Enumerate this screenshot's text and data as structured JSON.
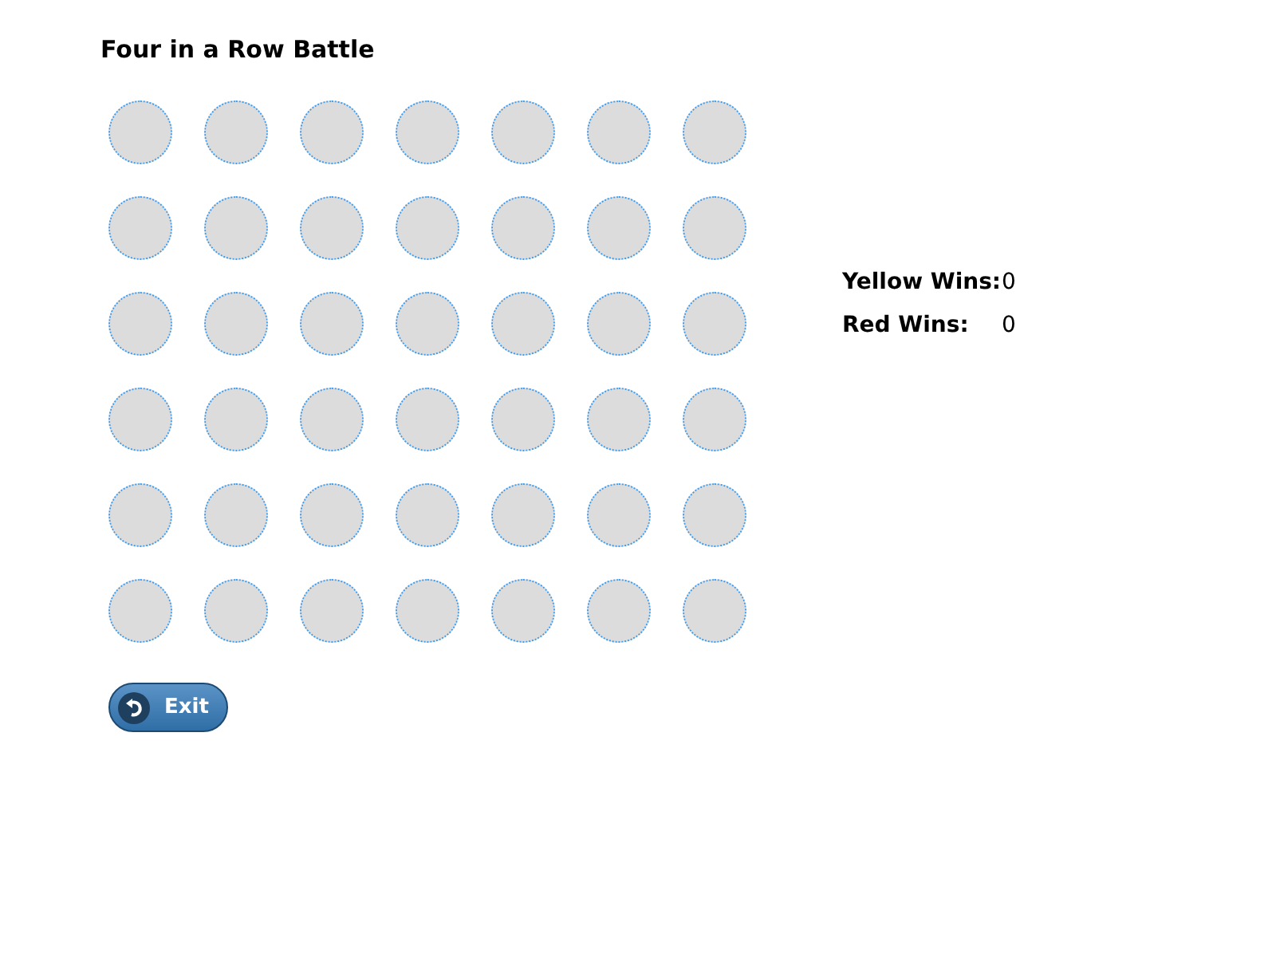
{
  "title": "Four in a Row Battle",
  "board": {
    "rows": [
      {
        "cells": [
          {
            "color": "#dcdcdc"
          },
          {
            "color": "#dcdcdc"
          },
          {
            "color": "#dcdcdc"
          },
          {
            "color": "#dcdcdc"
          },
          {
            "color": "#dcdcdc"
          },
          {
            "color": "#dcdcdc"
          },
          {
            "color": "#dcdcdc"
          }
        ]
      },
      {
        "cells": [
          {
            "color": "#dcdcdc"
          },
          {
            "color": "#dcdcdc"
          },
          {
            "color": "#dcdcdc"
          },
          {
            "color": "#dcdcdc"
          },
          {
            "color": "#dcdcdc"
          },
          {
            "color": "#dcdcdc"
          },
          {
            "color": "#dcdcdc"
          }
        ]
      },
      {
        "cells": [
          {
            "color": "#dcdcdc"
          },
          {
            "color": "#dcdcdc"
          },
          {
            "color": "#dcdcdc"
          },
          {
            "color": "#dcdcdc"
          },
          {
            "color": "#dcdcdc"
          },
          {
            "color": "#dcdcdc"
          },
          {
            "color": "#dcdcdc"
          }
        ]
      },
      {
        "cells": [
          {
            "color": "#dcdcdc"
          },
          {
            "color": "#dcdcdc"
          },
          {
            "color": "#dcdcdc"
          },
          {
            "color": "#dcdcdc"
          },
          {
            "color": "#dcdcdc"
          },
          {
            "color": "#dcdcdc"
          },
          {
            "color": "#dcdcdc"
          }
        ]
      },
      {
        "cells": [
          {
            "color": "#dcdcdc"
          },
          {
            "color": "#dcdcdc"
          },
          {
            "color": "#dcdcdc"
          },
          {
            "color": "#dcdcdc"
          },
          {
            "color": "#dcdcdc"
          },
          {
            "color": "#dcdcdc"
          },
          {
            "color": "#dcdcdc"
          }
        ]
      },
      {
        "cells": [
          {
            "color": "#dcdcdc"
          },
          {
            "color": "#dcdcdc"
          },
          {
            "color": "#dcdcdc"
          },
          {
            "color": "#dcdcdc"
          },
          {
            "color": "#dcdcdc"
          },
          {
            "color": "#dcdcdc"
          },
          {
            "color": "#dcdcdc"
          }
        ]
      }
    ]
  },
  "scores": [
    {
      "label": "Yellow Wins:",
      "value": "0"
    },
    {
      "label": "Red Wins:",
      "value": "0"
    }
  ],
  "exit_button": {
    "label": "Exit"
  }
}
